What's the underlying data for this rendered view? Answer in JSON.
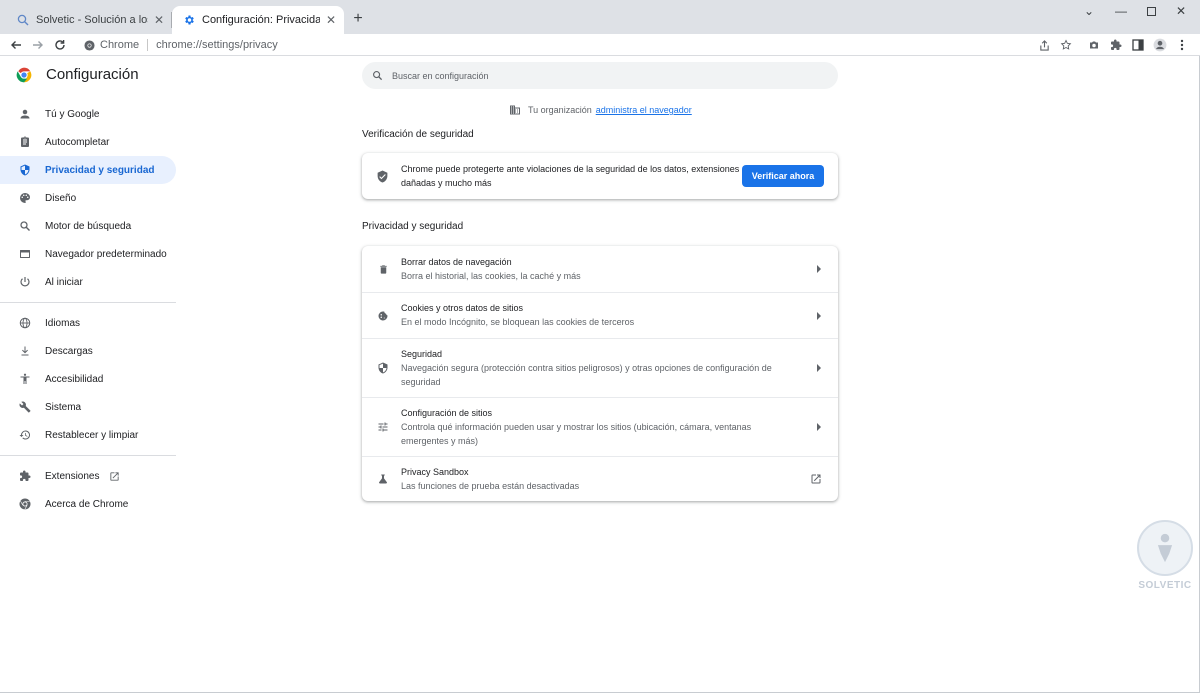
{
  "tabs": [
    {
      "title": "Solvetic - Solución a los problem",
      "icon": "search-globe-icon",
      "active": false
    },
    {
      "title": "Configuración: Privacidad y segu",
      "icon": "gear-icon",
      "active": true
    }
  ],
  "omnibox": {
    "site_chip": "Chrome",
    "url": "chrome://settings/privacy"
  },
  "settings": {
    "title": "Configuración",
    "search_placeholder": "Buscar en configuración",
    "managed": {
      "text": "Tu organización",
      "link": "administra el navegador"
    }
  },
  "nav": {
    "items": [
      {
        "label": "Tú y Google",
        "icon": "person-icon"
      },
      {
        "label": "Autocompletar",
        "icon": "clipboard-icon"
      },
      {
        "label": "Privacidad y seguridad",
        "icon": "shield-icon",
        "active": true
      },
      {
        "label": "Diseño",
        "icon": "palette-icon"
      },
      {
        "label": "Motor de búsqueda",
        "icon": "search-icon"
      },
      {
        "label": "Navegador predeterminado",
        "icon": "browser-window-icon"
      },
      {
        "label": "Al iniciar",
        "icon": "power-icon"
      }
    ],
    "items2": [
      {
        "label": "Idiomas",
        "icon": "globe-icon"
      },
      {
        "label": "Descargas",
        "icon": "download-icon"
      },
      {
        "label": "Accesibilidad",
        "icon": "accessibility-icon"
      },
      {
        "label": "Sistema",
        "icon": "wrench-icon"
      },
      {
        "label": "Restablecer y limpiar",
        "icon": "history-icon"
      }
    ],
    "items3": [
      {
        "label": "Extensiones",
        "icon": "puzzle-icon"
      },
      {
        "label": "Acerca de Chrome",
        "icon": "chrome-logo-icon"
      }
    ]
  },
  "safety_check": {
    "section_title": "Verificación de seguridad",
    "description": "Chrome puede protegerte ante violaciones de la seguridad de los datos, extensiones dañadas y mucho más",
    "button": "Verificar ahora"
  },
  "privacy": {
    "section_title": "Privacidad y seguridad",
    "rows": [
      {
        "title": "Borrar datos de navegación",
        "subtitle": "Borra el historial, las cookies, la caché y más",
        "icon": "trash-icon",
        "action": "arrow-right-icon"
      },
      {
        "title": "Cookies y otros datos de sitios",
        "subtitle": "En el modo Incógnito, se bloquean las cookies de terceros",
        "icon": "cookie-icon",
        "action": "arrow-right-icon"
      },
      {
        "title": "Seguridad",
        "subtitle": "Navegación segura (protección contra sitios peligrosos) y otras opciones de configuración de seguridad",
        "icon": "shield-icon",
        "action": "arrow-right-icon"
      },
      {
        "title": "Configuración de sitios",
        "subtitle": "Controla qué información pueden usar y mostrar los sitios (ubicación, cámara, ventanas emergentes y más)",
        "icon": "sliders-icon",
        "action": "arrow-right-icon"
      },
      {
        "title": "Privacy Sandbox",
        "subtitle": "Las funciones de prueba están desactivadas",
        "icon": "flask-icon",
        "action": "open-external-icon"
      }
    ]
  },
  "watermark": {
    "text": "SOLVETIC"
  },
  "colors": {
    "accent": "#1a73e8",
    "active_nav_bg": "#e8f0fe",
    "active_nav_text": "#1967d2",
    "tabstrip": "#dee1e6"
  }
}
